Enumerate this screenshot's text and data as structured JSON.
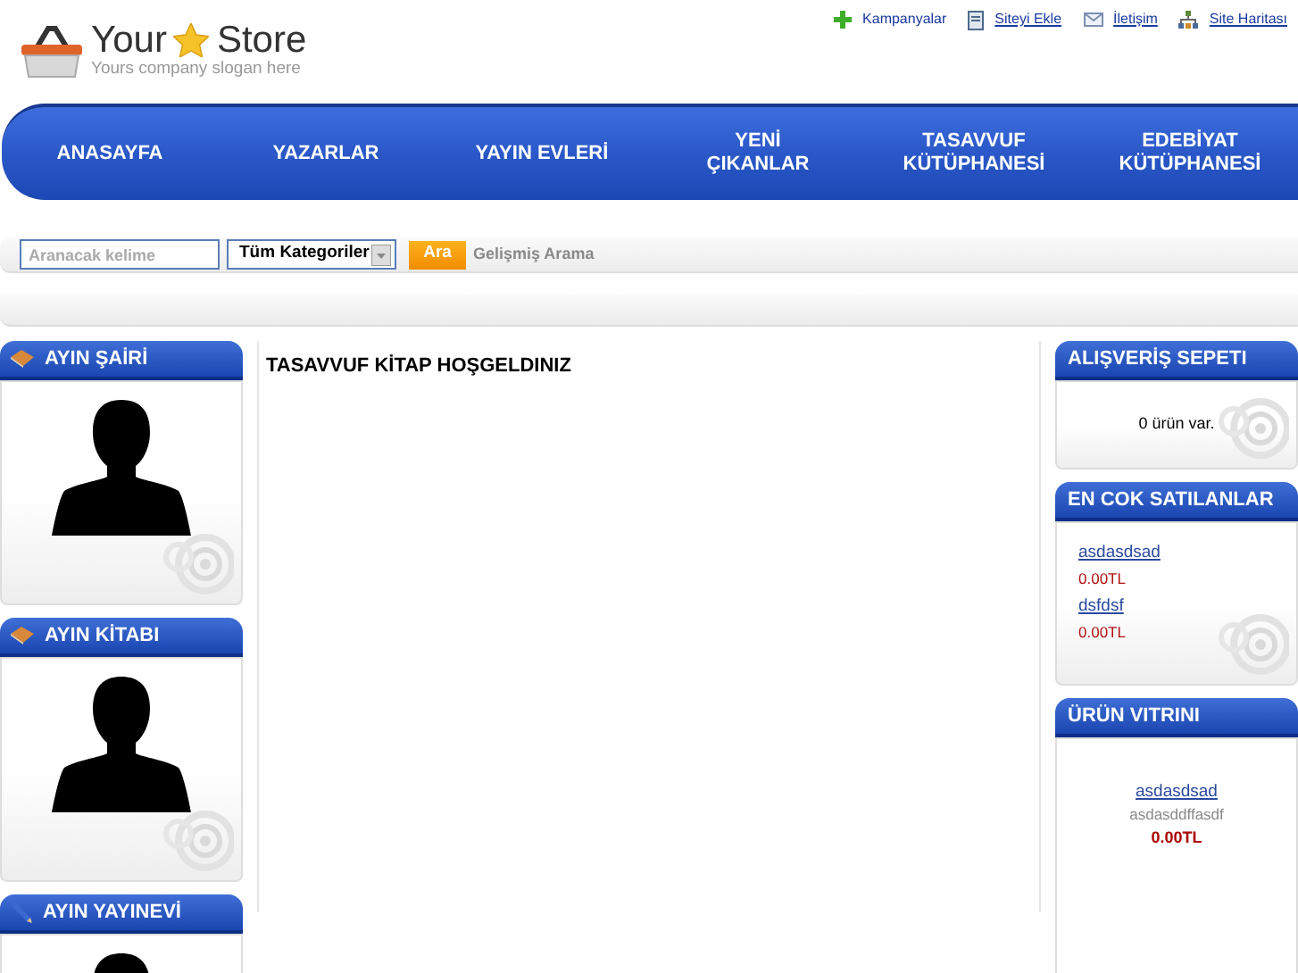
{
  "logo": {
    "word1": "Your",
    "word2": "Store",
    "slogan": "Yours company slogan here"
  },
  "top_links": [
    {
      "label": "Kampanyalar",
      "kind": "plus"
    },
    {
      "label": "Siteyi Ekle",
      "kind": "page"
    },
    {
      "label": "İletişim",
      "kind": "mail"
    },
    {
      "label": "Site Haritası",
      "kind": "sitemap"
    }
  ],
  "nav": [
    {
      "label": "ANASAYFA"
    },
    {
      "label": "YAZARLAR"
    },
    {
      "label": "YAYIN EVLERİ"
    },
    {
      "label": "YENİ\nÇIKANLAR"
    },
    {
      "label": "TASAVVUF\nKÜTÜPHANESİ"
    },
    {
      "label": "EDEBİYAT\nKÜTÜPHANESİ"
    }
  ],
  "search": {
    "placeholder": "Aranacak kelime",
    "category": "Tüm Kategoriler",
    "button": "Ara",
    "advanced": "Gelişmiş Arama"
  },
  "left_boxes": [
    {
      "title": "AYIN ŞAİRİ",
      "kind": "book"
    },
    {
      "title": "AYIN KİTABI",
      "kind": "book"
    },
    {
      "title": "AYIN YAYINEVİ",
      "kind": "pen"
    }
  ],
  "center": {
    "title": "TASAVVUF KİTAP HOŞGELDINIZ"
  },
  "cart": {
    "title": "ALIŞVERİŞ SEPETI",
    "text": "0 ürün var."
  },
  "bestsellers": {
    "title": "EN COK SATILANLAR",
    "items": [
      {
        "name": "asdasdsad",
        "price": "0.00TL"
      },
      {
        "name": "dsfdsf",
        "price": "0.00TL"
      }
    ]
  },
  "showcase": {
    "title": "ÜRÜN VITRINI",
    "name": "asdasdsad",
    "desc": "asdasddffasdf",
    "price": "0.00TL"
  }
}
